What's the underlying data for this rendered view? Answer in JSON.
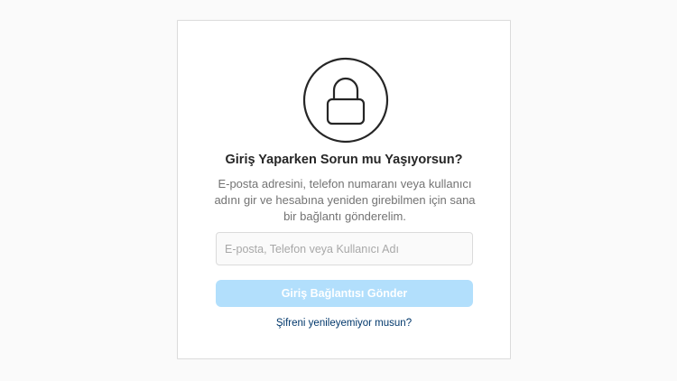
{
  "lock": {
    "icon": "lock-icon"
  },
  "form": {
    "title": "Giriş Yaparken Sorun mu Yaşıyorsun?",
    "description": "E-posta adresini, telefon numaranı veya kullanıcı adını gir ve hesabına yeniden girebilmen için sana bir bağlantı gönderelim.",
    "input_placeholder": "E-posta, Telefon veya Kullanıcı Adı",
    "input_value": "",
    "send_button_label": "Giriş Bağlantısı Gönder",
    "reset_link_label": "Şifreni yenileyemiyor musun?"
  },
  "colors": {
    "button_disabled": "#b2dffc",
    "link": "#00376b",
    "text_primary": "#262626",
    "text_secondary": "#737373",
    "border": "#dbdbdb"
  }
}
